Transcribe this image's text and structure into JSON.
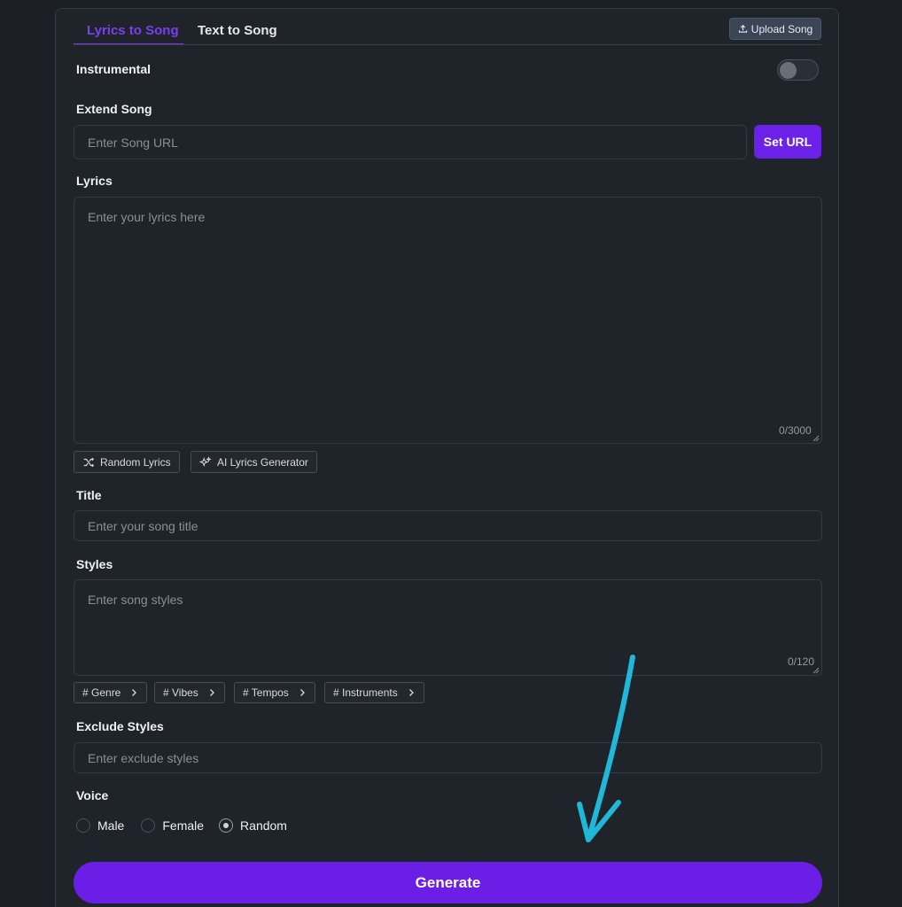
{
  "tabs": [
    {
      "label": "Lyrics to Song",
      "active": true
    },
    {
      "label": "Text to Song",
      "active": false
    }
  ],
  "upload_label": "Upload Song",
  "instrumental": {
    "label": "Instrumental",
    "enabled": false
  },
  "extend": {
    "label": "Extend Song",
    "placeholder": "Enter Song URL",
    "button": "Set URL"
  },
  "lyrics": {
    "label": "Lyrics",
    "placeholder": "Enter your lyrics here",
    "counter": "0/3000"
  },
  "lyrics_actions": [
    "Random Lyrics",
    "AI Lyrics Generator"
  ],
  "title_field": {
    "label": "Title",
    "placeholder": "Enter your song title"
  },
  "styles": {
    "label": "Styles",
    "placeholder": "Enter song styles",
    "counter": "0/120"
  },
  "style_chips": [
    "# Genre",
    "# Vibes",
    "# Tempos",
    "# Instruments"
  ],
  "exclude": {
    "label": "Exclude Styles",
    "placeholder": "Enter exclude styles"
  },
  "voice": {
    "label": "Voice",
    "options": [
      "Male",
      "Female",
      "Random"
    ],
    "selected": "Random"
  },
  "generate_label": "Generate",
  "colors": {
    "accent": "#6a1ee6",
    "annotation_arrow": "#1fb8d8",
    "background": "#1b1e24"
  }
}
